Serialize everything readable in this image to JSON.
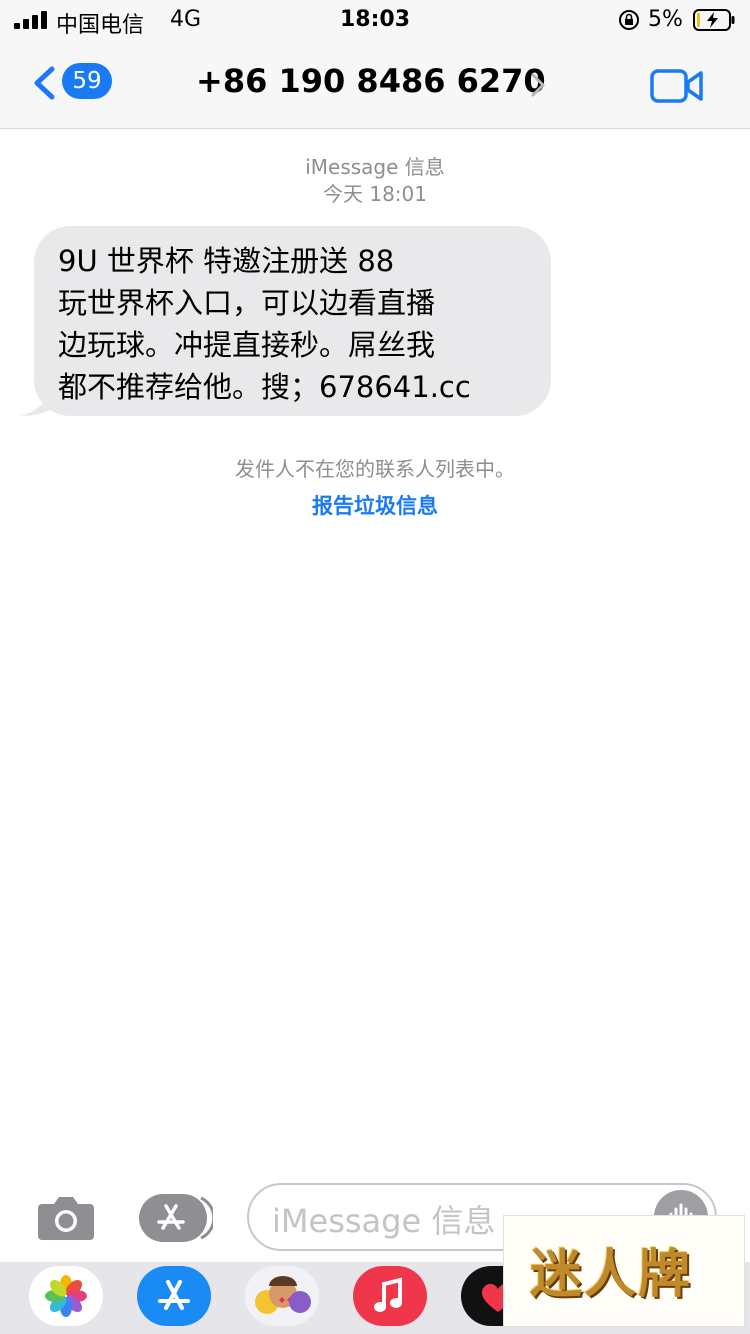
{
  "status_bar": {
    "carrier": "中国电信",
    "network": "4G",
    "time": "18:03",
    "battery_percent": "5%"
  },
  "nav": {
    "back_badge": "59",
    "contact": "+86 190 8486 6270"
  },
  "conversation": {
    "service": "iMessage 信息",
    "date": "今天 18:01",
    "message_lines": [
      "9U 世界杯 特邀注册送 88",
      "玩世界杯入口，可以边看直播",
      "边玩球。冲提直接秒。屌丝我",
      "都不推荐给他。搜；678641.cc"
    ],
    "unknown_sender_notice": "发件人不在您的联系人列表中。",
    "report_link": "报告垃圾信息"
  },
  "input_bar": {
    "placeholder": "iMessage 信息"
  },
  "watermark": {
    "text": "迷人牌"
  },
  "colors": {
    "accent": "#1a7af5",
    "bubble": "#e9e9eb",
    "secondary_text": "#8e8e93"
  },
  "icons": [
    "camera-icon",
    "app-store-icon",
    "audio-message-icon",
    "video-call-icon",
    "back-chevron-icon",
    "lock-rotation-icon",
    "battery-icon"
  ]
}
